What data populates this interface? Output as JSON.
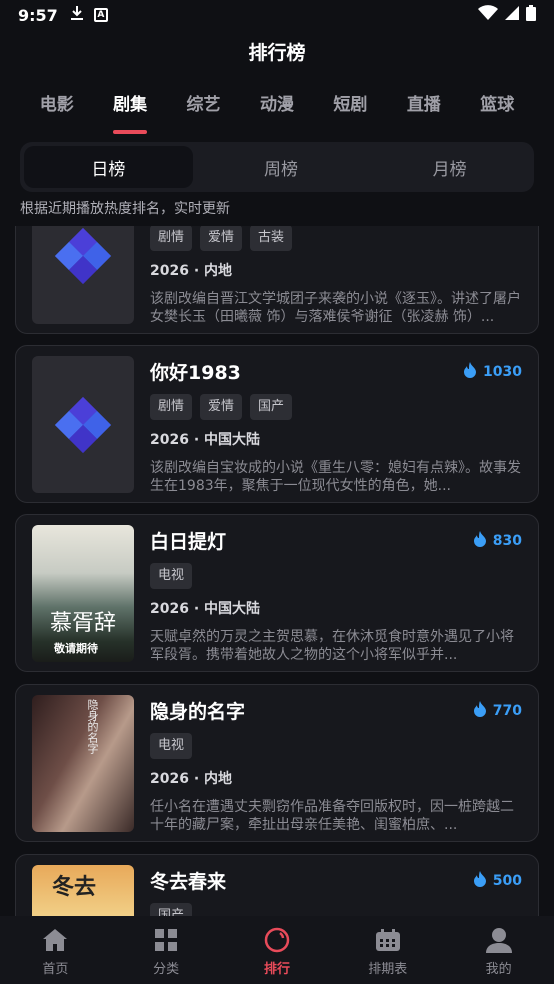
{
  "status": {
    "time": "9:57"
  },
  "header": {
    "title": "排行榜"
  },
  "tabs": [
    "电影",
    "剧集",
    "综艺",
    "动漫",
    "短剧",
    "直播",
    "篮球"
  ],
  "segments": [
    "日榜",
    "周榜",
    "月榜"
  ],
  "hint": "根据近期播放热度排名，实时更新",
  "cards": [
    {
      "name": "",
      "hot": "",
      "tags": [
        "剧情",
        "爱情",
        "古装"
      ],
      "meta": "2026 · 内地",
      "desc": "该剧改编自晋江文学城团子来袭的小说《逐玉》。讲述了屠户女樊长玉（田曦薇 饰）与落难侯爷谢征（张凌赫 饰）..."
    },
    {
      "name": "你好1983",
      "hot": "1030",
      "tags": [
        "剧情",
        "爱情",
        "国产"
      ],
      "meta": "2026 · 中国大陆",
      "desc": "该剧改编自宝妆成的小说《重生八零：媳妇有点辣》。故事发生在1983年，聚焦于一位现代女性的角色，她..."
    },
    {
      "name": "白日提灯",
      "hot": "830",
      "tags": [
        "电视"
      ],
      "meta": "2026 · 中国大陆",
      "desc": "天赋卓然的万灵之主贺思慕，在休沐觅食时意外遇见了小将军段胥。携带着她故人之物的这个小将军似乎并..."
    },
    {
      "name": "隐身的名字",
      "hot": "770",
      "tags": [
        "电视"
      ],
      "meta": "2026 · 内地",
      "desc": "任小名在遭遇丈夫剽窃作品准备夺回版权时，因一桩跨越二十年的藏尸案，牵扯出母亲任美艳、闺蜜柏庶、..."
    },
    {
      "name": "冬去春来",
      "hot": "500",
      "tags": [
        "国产"
      ],
      "meta": "",
      "desc": ""
    }
  ],
  "posters": {
    "p3_title": "慕胥辞",
    "p3_sub": "敬请期待",
    "p4_title": "隐身的名字",
    "p5_title": "冬去"
  },
  "nav": [
    "首页",
    "分类",
    "排行",
    "排期表",
    "我的"
  ],
  "colors": {
    "accent": "#e94b5a",
    "hot": "#3b9ef7"
  }
}
